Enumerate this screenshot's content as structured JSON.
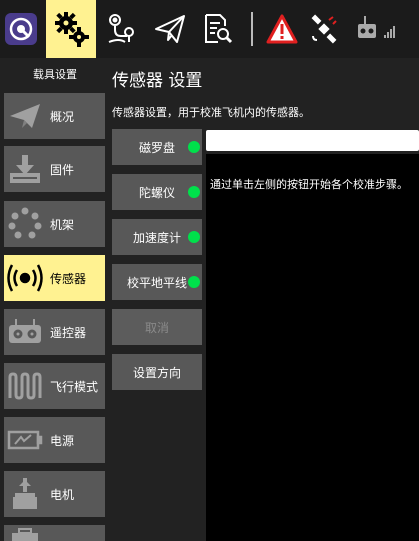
{
  "sidebar": {
    "title": "载具设置",
    "items": [
      {
        "label": "概况",
        "icon": "plane-icon",
        "active": false
      },
      {
        "label": "固件",
        "icon": "download-icon",
        "active": false
      },
      {
        "label": "机架",
        "icon": "airframe-icon",
        "active": false
      },
      {
        "label": "传感器",
        "icon": "sensor-icon",
        "active": true
      },
      {
        "label": "遥控器",
        "icon": "remote-icon",
        "active": false
      },
      {
        "label": "飞行模式",
        "icon": "wave-icon",
        "active": false
      },
      {
        "label": "电源",
        "icon": "battery-icon",
        "active": false
      },
      {
        "label": "电机",
        "icon": "motor-icon",
        "active": false
      }
    ]
  },
  "panel": {
    "title": "传感器 设置",
    "description": "传感器设置，用于校准飞机内的传感器。",
    "buttons": [
      {
        "label": "磁罗盘",
        "status": "green"
      },
      {
        "label": "陀螺仪",
        "status": "green"
      },
      {
        "label": "加速度计",
        "status": "green"
      },
      {
        "label": "校平地平线",
        "status": "green"
      },
      {
        "label": "取消",
        "status": "disabled"
      },
      {
        "label": "设置方向",
        "status": "none"
      }
    ],
    "progress": 0,
    "status_text": "通过单击左侧的按钮开始各个校准步骤。"
  },
  "colors": {
    "highlight": "#fff291",
    "button_bg": "#585858",
    "ok_dot": "#00e04b",
    "warning": "#e02020",
    "background": "#222222"
  }
}
